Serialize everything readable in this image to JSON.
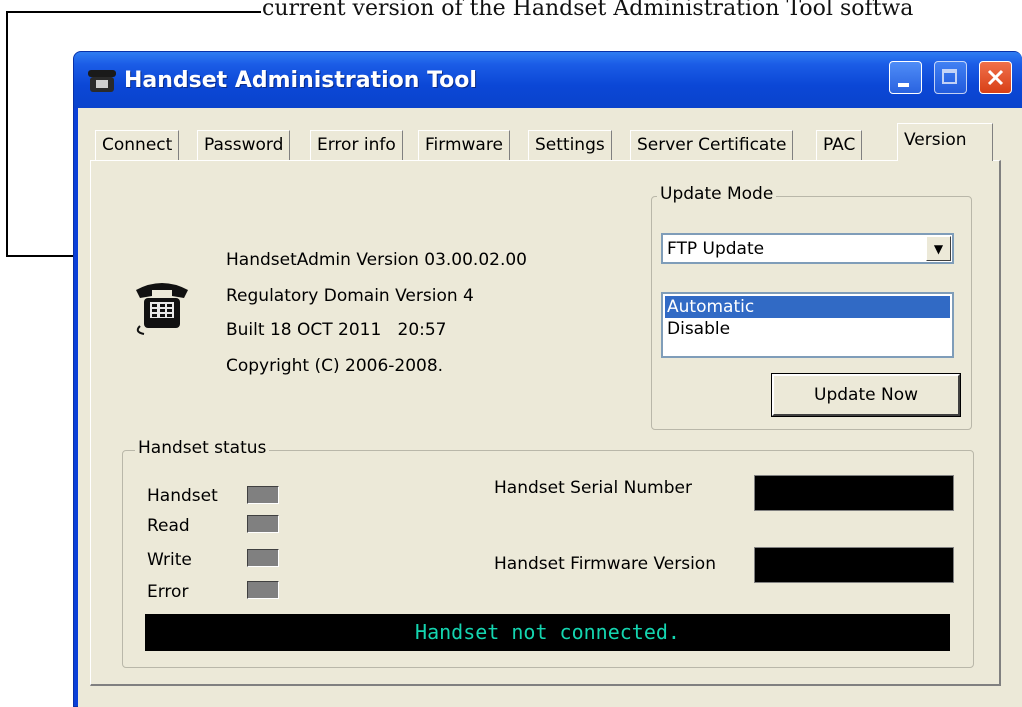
{
  "caption": "current version of the Handset Administration Tool softwa",
  "window": {
    "title": "Handset Administration Tool",
    "title_icon": "telephone-icon",
    "controls": [
      "minimize-icon",
      "maximize-icon",
      "close-icon"
    ]
  },
  "tabs": [
    {
      "label": "Connect"
    },
    {
      "label": "Password"
    },
    {
      "label": "Error info"
    },
    {
      "label": "Firmware"
    },
    {
      "label": "Settings"
    },
    {
      "label": "Server Certificate"
    },
    {
      "label": "PAC"
    },
    {
      "label": "Version",
      "active": true
    }
  ],
  "version_info": {
    "icon": "telephone-icon",
    "lines": [
      "HandsetAdmin Version 03.00.02.00",
      "Regulatory Domain Version 4",
      "Built 18 OCT 2011   20:57",
      "Copyright (C) 2006-2008."
    ]
  },
  "update_mode": {
    "title": "Update Mode",
    "selected": "FTP Update",
    "list": [
      "Automatic",
      "Disable"
    ],
    "list_selected": "Automatic",
    "button": "Update Now"
  },
  "handset_status": {
    "title": "Handset status",
    "indicators": [
      "Handset",
      "Read",
      "Write",
      "Error"
    ],
    "serial_label": "Handset Serial Number",
    "firmware_label": "Handset Firmware Version",
    "message": "Handset not connected."
  },
  "colors": {
    "titlebar": "#0b47d6",
    "status_text": "#14d5b0",
    "selection": "#316ac5"
  }
}
